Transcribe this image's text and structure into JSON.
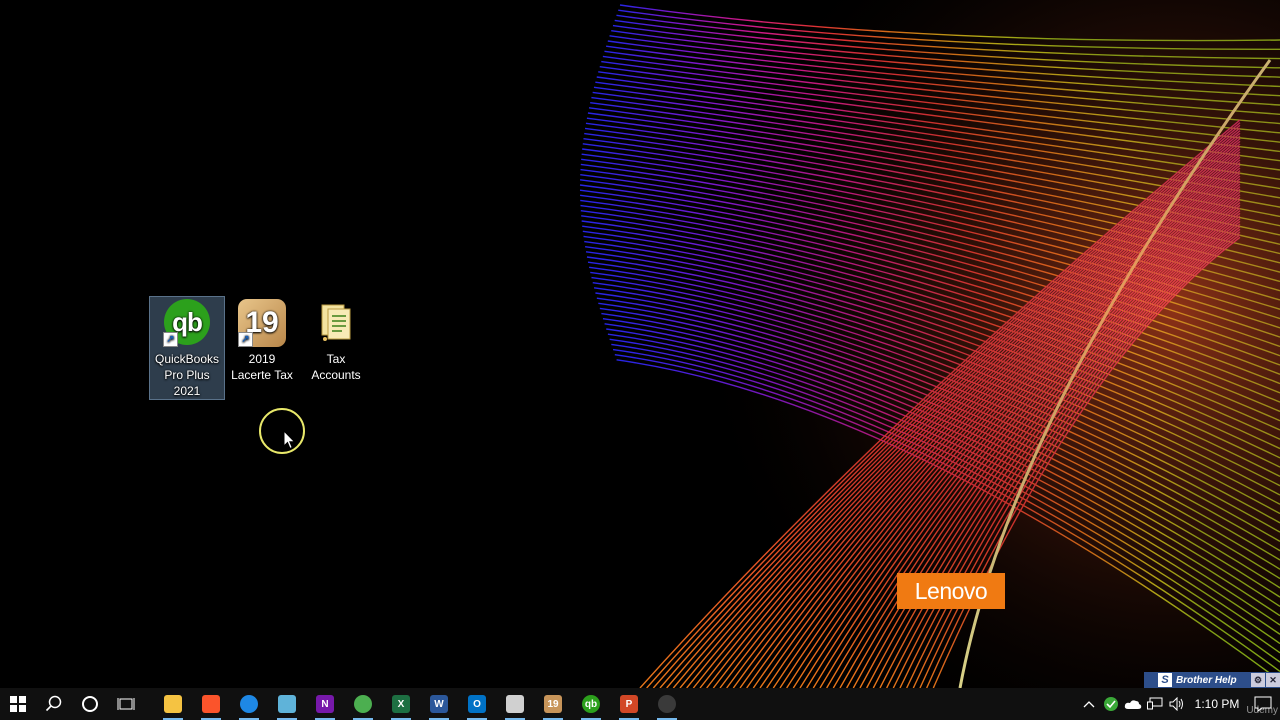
{
  "desktop": {
    "icons": [
      {
        "label": "QuickBooks Pro Plus 2021",
        "icon": "quickbooks-icon",
        "glyph": "qb",
        "selected": true
      },
      {
        "label": "2019 Lacerte Tax",
        "icon": "lacerte-icon",
        "glyph": "19",
        "selected": false
      },
      {
        "label": "Tax Accounts",
        "icon": "folder-icon",
        "selected": false
      }
    ],
    "brand_badge": "Lenovo"
  },
  "brother_help": {
    "label": "Brother Help",
    "logo": "S"
  },
  "taskbar": {
    "start_icon": "windows-start-icon",
    "search_icon": "search-icon",
    "cortana_icon": "cortana-icon",
    "taskview_icon": "task-view-icon",
    "apps": [
      {
        "name": "file-explorer",
        "glyph": "",
        "color": "#f5c342",
        "running": true
      },
      {
        "name": "brave",
        "glyph": "",
        "color": "#fb542b",
        "running": true
      },
      {
        "name": "edge",
        "glyph": "",
        "color": "#1e88e5",
        "running": true
      },
      {
        "name": "snipping-tool",
        "glyph": "",
        "color": "#5fb3d9",
        "running": true
      },
      {
        "name": "onenote",
        "glyph": "N",
        "color": "#7719aa",
        "running": true
      },
      {
        "name": "chrome",
        "glyph": "",
        "color": "#4caf50",
        "running": true
      },
      {
        "name": "excel",
        "glyph": "X",
        "color": "#1d6f42",
        "running": true
      },
      {
        "name": "word",
        "glyph": "W",
        "color": "#2b579a",
        "running": true
      },
      {
        "name": "outlook",
        "glyph": "O",
        "color": "#0072c6",
        "running": true
      },
      {
        "name": "paint",
        "glyph": "",
        "color": "#d0d0d0",
        "running": true
      },
      {
        "name": "lacerte",
        "glyph": "19",
        "color": "#c8955a",
        "running": true
      },
      {
        "name": "quickbooks",
        "glyph": "qb",
        "color": "#2ca01c",
        "running": true
      },
      {
        "name": "powerpoint",
        "glyph": "P",
        "color": "#d24726",
        "running": true
      },
      {
        "name": "obs",
        "glyph": "",
        "color": "#3a3a3a",
        "running": true
      }
    ],
    "tray": {
      "time": "1:10 PM",
      "watermark": "Udemy"
    }
  }
}
